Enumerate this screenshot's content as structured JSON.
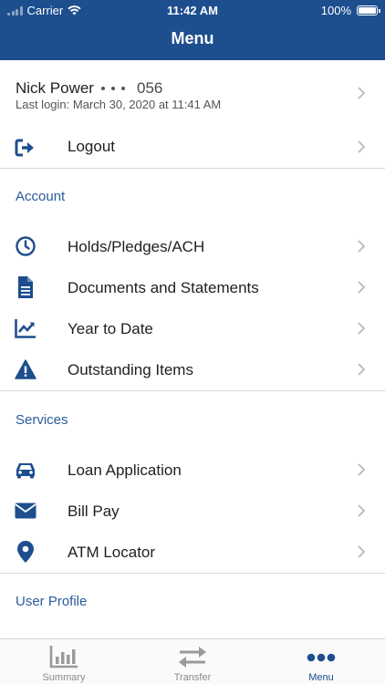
{
  "status_bar": {
    "carrier": "Carrier",
    "time": "11:42 AM",
    "battery": "100%"
  },
  "header": {
    "title": "Menu"
  },
  "user": {
    "name": "Nick Power",
    "account_suffix": "056",
    "last_login": "Last login: March 30, 2020 at 11:41 AM"
  },
  "logout": {
    "label": "Logout",
    "icon": "logout-icon"
  },
  "account": {
    "title": "Account",
    "items": [
      {
        "label": "Holds/Pledges/ACH",
        "icon": "clock-icon"
      },
      {
        "label": "Documents and Statements",
        "icon": "document-icon"
      },
      {
        "label": "Year to Date",
        "icon": "chart-line-icon"
      },
      {
        "label": "Outstanding Items",
        "icon": "warning-icon"
      }
    ]
  },
  "services": {
    "title": "Services",
    "items": [
      {
        "label": "Loan Application",
        "icon": "car-icon"
      },
      {
        "label": "Bill Pay",
        "icon": "envelope-icon"
      },
      {
        "label": "ATM Locator",
        "icon": "map-pin-icon"
      }
    ]
  },
  "user_profile": {
    "title": "User Profile"
  },
  "tabbar": {
    "items": [
      {
        "label": "Summary",
        "icon": "bar-chart-icon",
        "active": false
      },
      {
        "label": "Transfer",
        "icon": "transfer-arrows-icon",
        "active": false
      },
      {
        "label": "Menu",
        "icon": "more-dots-icon",
        "active": true
      }
    ]
  },
  "colors": {
    "brand": "#1d4e8e",
    "section": "#2a5c9a",
    "icon": "#1d4e8e",
    "chevron": "#b8b8b8"
  }
}
